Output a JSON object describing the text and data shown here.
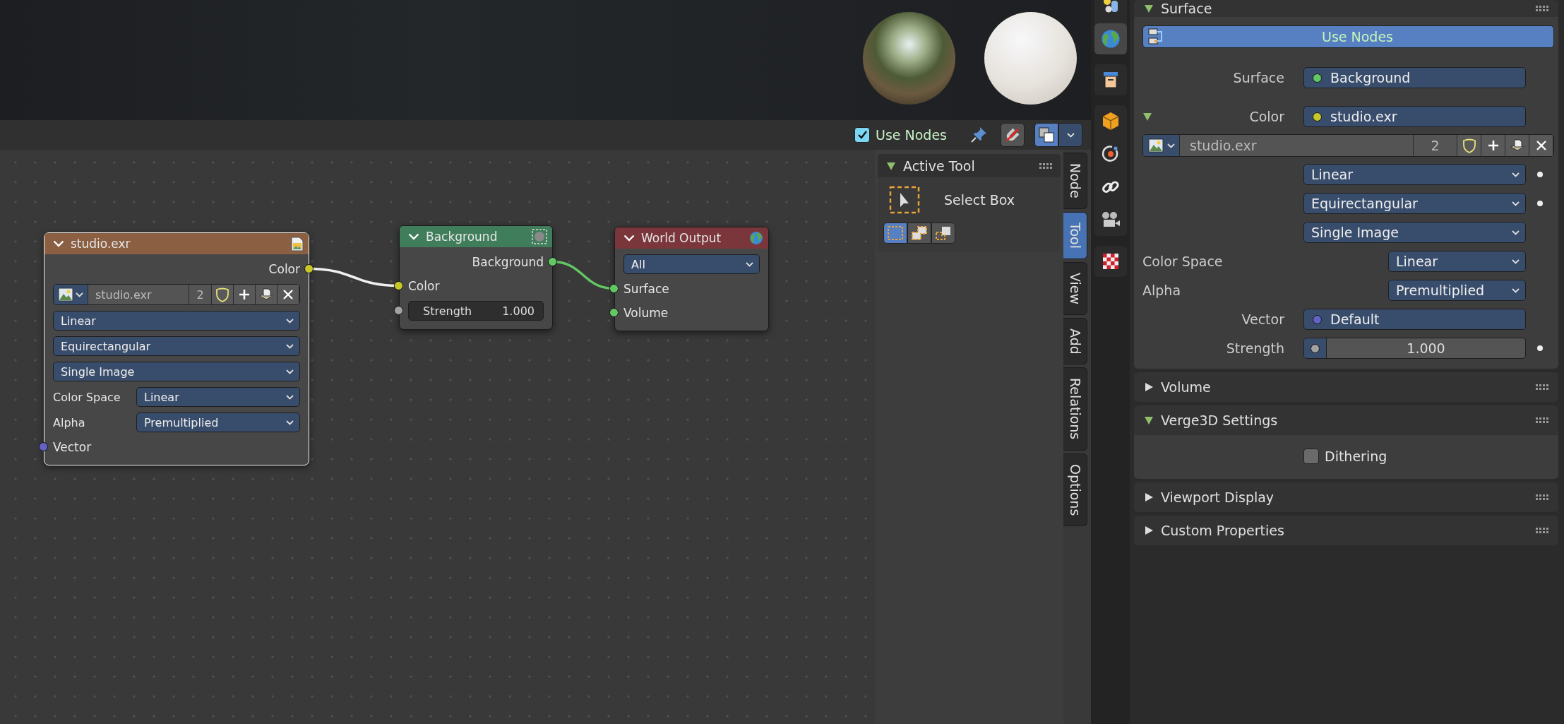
{
  "node_editor": {
    "header": {
      "use_nodes": {
        "label": "Use Nodes",
        "checked": true
      },
      "pinned": false,
      "snap": false,
      "overlay": true
    },
    "nodes": [
      {
        "kind": "image",
        "title": "studio.exr",
        "color": "#8a5f42",
        "selected": true,
        "outputs": [
          {
            "label": "Color",
            "color": "#c7c729",
            "linked": true
          }
        ],
        "image": {
          "name": "studio.exr",
          "users": "2"
        },
        "options": [
          {
            "value": "Linear"
          },
          {
            "value": "Equirectangular"
          },
          {
            "value": "Single Image"
          },
          {
            "label": "Color Space",
            "value": "Linear"
          },
          {
            "label": "Alpha",
            "value": "Premultiplied"
          }
        ],
        "inputs": [
          {
            "label": "Vector",
            "color": "#6363c7",
            "linked": false
          }
        ]
      },
      {
        "kind": "shader",
        "title": "Background",
        "color": "#3f7d5b",
        "selected": false,
        "outputs": [
          {
            "label": "Background",
            "color": "#63c763",
            "linked": true
          }
        ],
        "inputs": [
          {
            "label": "Color",
            "color": "#c7c729",
            "linked": true
          },
          {
            "label": "Strength",
            "value": "1.000",
            "color": "#a1a1a1",
            "linked": false
          }
        ]
      },
      {
        "kind": "output",
        "title": "World Output",
        "color": "#7a363b",
        "selected": false,
        "options": [
          {
            "value": "All"
          }
        ],
        "inputs": [
          {
            "label": "Surface",
            "color": "#63c763",
            "linked": true
          },
          {
            "label": "Volume",
            "color": "#63c763",
            "linked": false
          }
        ]
      }
    ],
    "sidebar": {
      "panels": [
        {
          "title": "Active Tool",
          "expanded": true,
          "tool": "Select Box",
          "modes": [
            {
              "kind": "set",
              "selected": true
            },
            {
              "kind": "extend",
              "selected": false
            },
            {
              "kind": "subtract",
              "selected": false
            }
          ]
        }
      ],
      "tabs": [
        {
          "label": "Node",
          "selected": false
        },
        {
          "label": "Tool",
          "selected": true
        },
        {
          "label": "View",
          "selected": false
        },
        {
          "label": "Add",
          "selected": false
        },
        {
          "label": "Relations",
          "selected": false
        },
        {
          "label": "Options",
          "selected": false
        }
      ]
    }
  },
  "properties": {
    "tabs": [
      [
        {
          "kind": "scene",
          "selected": false
        },
        {
          "kind": "world",
          "selected": true
        }
      ],
      [
        {
          "kind": "collection",
          "selected": false
        }
      ],
      [
        {
          "kind": "object",
          "selected": false
        },
        {
          "kind": "physics",
          "selected": false
        },
        {
          "kind": "constraints",
          "selected": false
        },
        {
          "kind": "data",
          "selected": false
        }
      ],
      [
        {
          "kind": "texture",
          "selected": false
        }
      ]
    ],
    "sections": [
      {
        "title": "Surface",
        "expanded": true,
        "rows": [
          {
            "kind": "toggle_button",
            "label": "Use Nodes",
            "on": true
          },
          {
            "kind": "socket",
            "label": "Surface",
            "value": "Background",
            "color": "#63c763",
            "expanded": false
          },
          {
            "kind": "socket",
            "label": "Color",
            "value": "studio.exr",
            "color": "#c7c729",
            "expanded": true
          },
          {
            "kind": "image",
            "name": "studio.exr",
            "users": "2"
          },
          {
            "kind": "dropdown",
            "value": "Linear",
            "decorated": true
          },
          {
            "kind": "dropdown",
            "value": "Equirectangular",
            "decorated": true
          },
          {
            "kind": "dropdown",
            "value": "Single Image",
            "decorated": false
          },
          {
            "kind": "setting",
            "label": "Color Space",
            "value": "Linear"
          },
          {
            "kind": "setting",
            "label": "Alpha",
            "value": "Premultiplied"
          },
          {
            "kind": "socket",
            "label": "Vector",
            "value": "Default",
            "color": "#6363c7",
            "expanded": false
          },
          {
            "kind": "number",
            "label": "Strength",
            "value": "1.000",
            "color": "#a1a1a1",
            "decorated": true
          }
        ]
      },
      {
        "title": "Volume",
        "expanded": false
      },
      {
        "title": "Verge3D Settings",
        "expanded": true,
        "rows": [
          {
            "kind": "checkbox",
            "label": "Dithering",
            "checked": false
          }
        ]
      },
      {
        "title": "Viewport Display",
        "expanded": false
      },
      {
        "title": "Custom Properties",
        "expanded": false
      }
    ]
  }
}
